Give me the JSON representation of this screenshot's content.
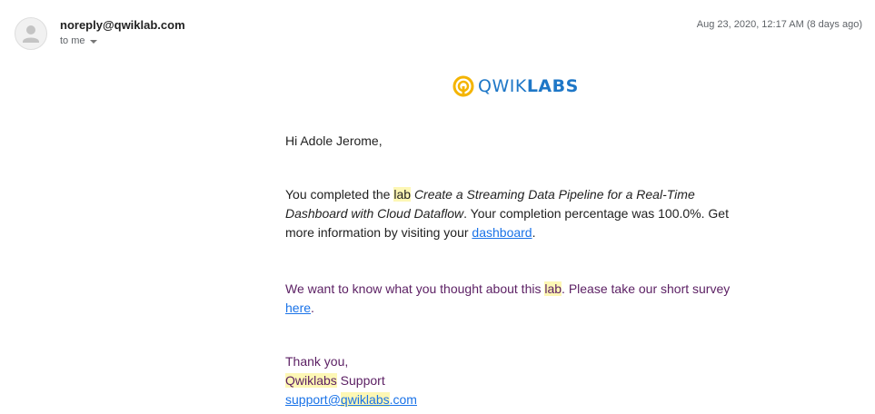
{
  "header": {
    "sender": "noreply@qwiklab.com",
    "recipient": "to me",
    "date": "Aug 23, 2020, 12:17 AM (8 days ago)"
  },
  "logo": {
    "text_light": "QWIK",
    "text_bold": "LABS",
    "brand_color": "#1e77c7",
    "icon_color": "#f4b400"
  },
  "email": {
    "greeting": "Hi Adole Jerome,",
    "completion": {
      "prefix": "You completed the ",
      "lab_word": "lab",
      "space": " ",
      "lab_title": "Create a Streaming Data Pipeline for a Real-Time Dashboard with Cloud Dataflow",
      "middle": ". Your completion percentage was 100.0%. Get more information by visiting your ",
      "link": "dashboard",
      "end": "."
    },
    "survey": {
      "prefix": "We want to know what you thought about this ",
      "lab_word": "lab",
      "middle": ". Please take our short survey ",
      "link": "here",
      "end": "."
    },
    "signoff": {
      "thanks": "Thank you,",
      "team_brand": "Qwiklabs",
      "team_rest": " Support",
      "email_user": "support@",
      "email_brand": "qwiklabs",
      "email_domain": ".com"
    }
  }
}
